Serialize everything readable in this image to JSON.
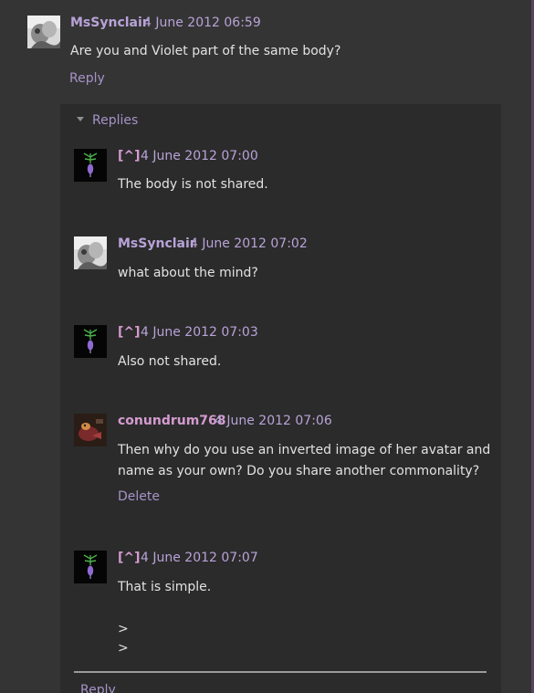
{
  "top_comment": {
    "author": "MsSynclair",
    "timestamp": "4 June 2012 06:59",
    "text": "Are you and Violet part of the same body?",
    "reply_label": "Reply"
  },
  "replies": {
    "toggle_label": "Replies",
    "items": [
      {
        "author": "[^]",
        "timestamp": "4 June 2012 07:00",
        "text": "The body is not shared."
      },
      {
        "author": "MsSynclair",
        "timestamp": "4 June 2012 07:02",
        "text": "what about the mind?"
      },
      {
        "author": "[^]",
        "timestamp": "4 June 2012 07:03",
        "text": "Also not shared."
      },
      {
        "author": "conundrum768",
        "timestamp": "4 June 2012 07:06",
        "text_line1": "Then why do you use an inverted image of her avatar and",
        "text_line2": "name as your own? Do you share another commonality?",
        "delete_label": "Delete"
      },
      {
        "author": "[^]",
        "timestamp": "4 June 2012 07:07",
        "text": "That is simple.",
        "quote_line1": ">",
        "quote_line2": ">"
      }
    ],
    "reply_label": "Reply"
  },
  "colors": {
    "background": "#343434",
    "panel": "#2b2b2b",
    "accent_link": "#a693c9",
    "author_pink": "#d49bcf"
  }
}
